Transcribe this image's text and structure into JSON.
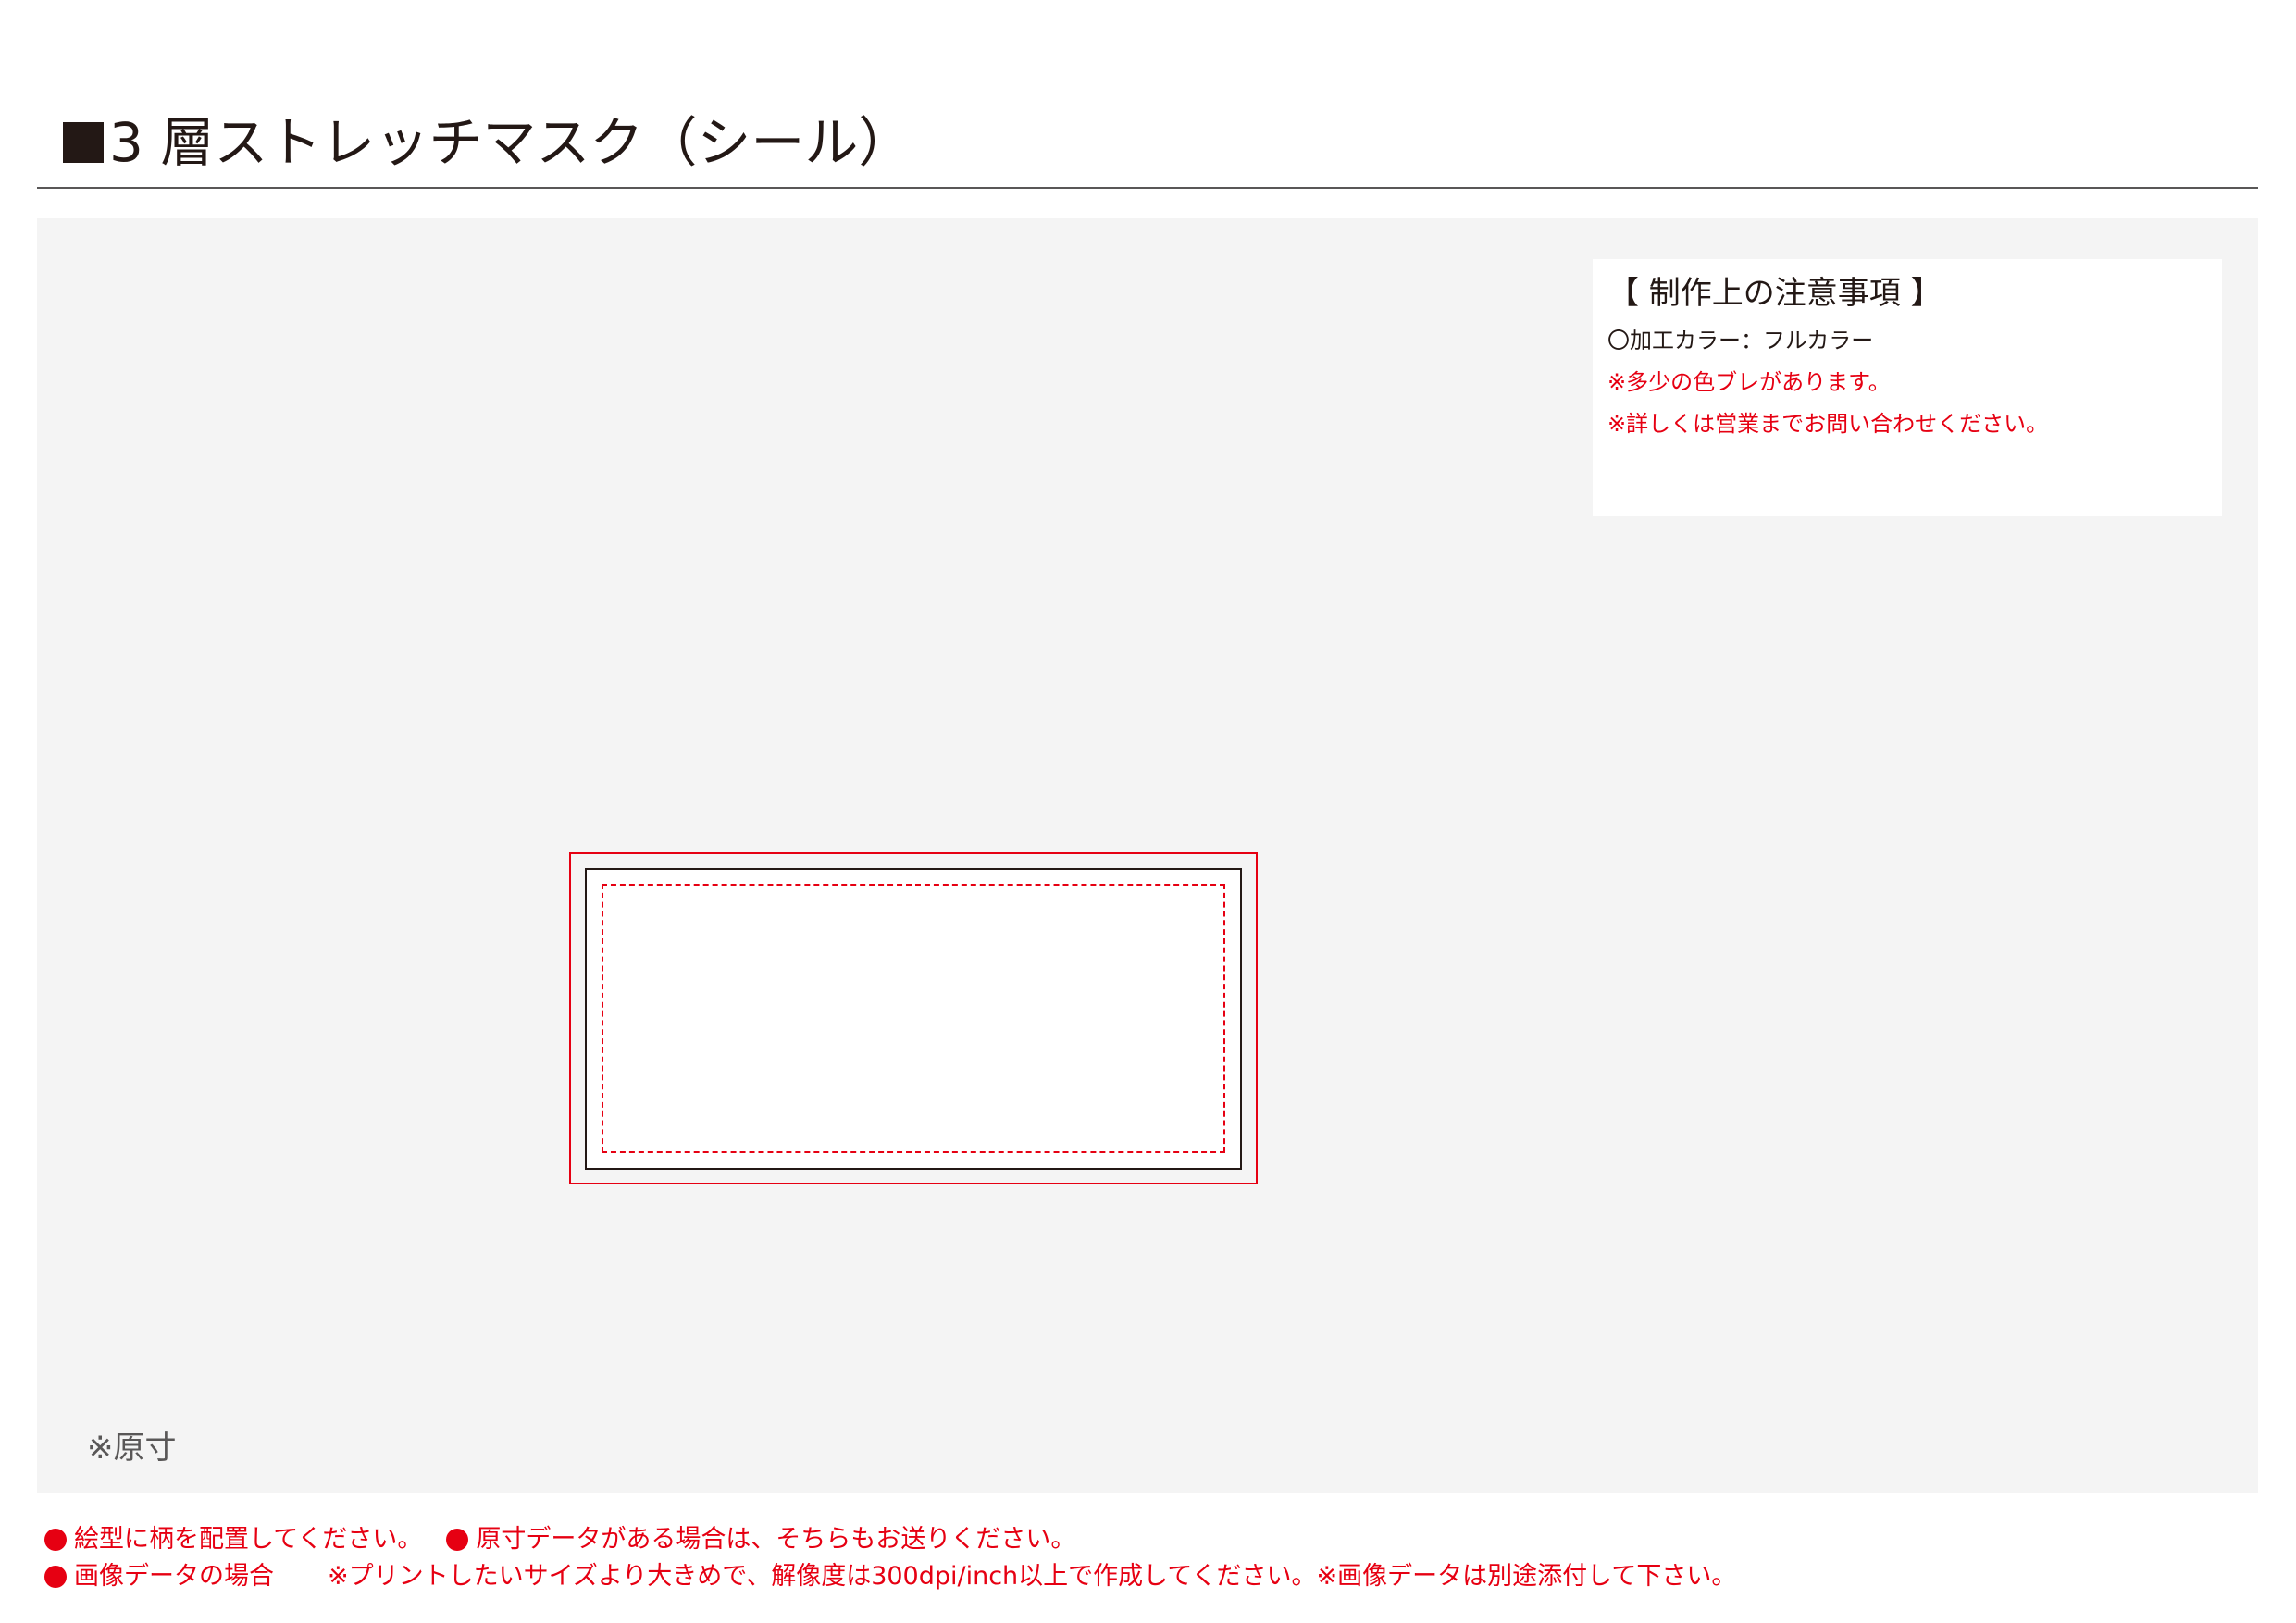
{
  "title": {
    "text": "3 層ストレッチマスク（シール）"
  },
  "notes": {
    "heading": "【 制作上の注意事項 】",
    "lines": [
      "〇加工カラー：フルカラー",
      "※多少の色ブレがあります。",
      "※詳しくは営業までお問い合わせください。"
    ]
  },
  "scale_note": "※原寸",
  "footer": {
    "line1": [
      "絵型に柄を配置してください。",
      "原寸データがある場合は、そちらもお送りください。"
    ],
    "line2": {
      "label": "画像データの場合",
      "text": "※プリントしたいサイズより大きめで、解像度は300dpi/inch以上で作成してください。※画像データは別途添付して下さい。"
    }
  },
  "colors": {
    "accent_red": "#e60012",
    "text_dark": "#231815",
    "canvas_background": "#f4f4f4"
  }
}
